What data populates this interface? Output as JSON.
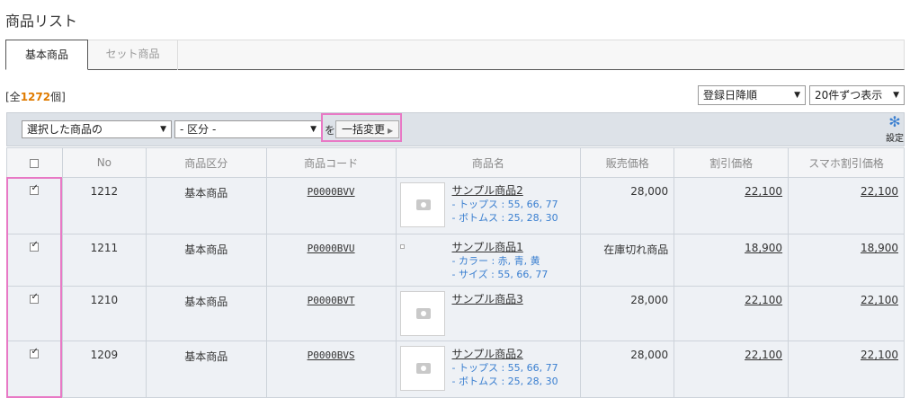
{
  "page_title": "商品リスト",
  "tabs": [
    {
      "label": "基本商品",
      "active": true
    },
    {
      "label": "セット商品",
      "active": false
    }
  ],
  "count": {
    "prefix": "[全",
    "number": "1272",
    "suffix": "個]"
  },
  "sort_select": {
    "value": "登録日降順"
  },
  "per_page_select": {
    "value": "20件ずつ表示"
  },
  "bulk": {
    "target_select": "選択した商品の",
    "category_select": "- 区分 -",
    "wo_label": "を",
    "button_label": "一括変更"
  },
  "settings_label": "設定",
  "columns": [
    "No",
    "商品区分",
    "商品コード",
    "商品名",
    "販売価格",
    "割引価格",
    "スマホ割引価格"
  ],
  "rows": [
    {
      "checked": true,
      "no": "1212",
      "type": "基本商品",
      "code": "P0000BVV",
      "has_thumb": true,
      "name": "サンプル商品2",
      "variants": [
        "- トップス : 55, 66, 77",
        "- ボトムス : 25, 28, 30"
      ],
      "price": "28,000",
      "discount": "22,100",
      "mobile_discount": "22,100"
    },
    {
      "checked": true,
      "no": "1211",
      "type": "基本商品",
      "code": "P0000BVU",
      "has_thumb": false,
      "name": "サンプル商品1",
      "variants": [
        "- カラー : 赤, 青, 黄",
        "- サイズ : 55, 66, 77"
      ],
      "price": "在庫切れ商品",
      "discount": "18,900",
      "mobile_discount": "18,900"
    },
    {
      "checked": true,
      "no": "1210",
      "type": "基本商品",
      "code": "P0000BVT",
      "has_thumb": true,
      "name": "サンプル商品3",
      "variants": [],
      "price": "28,000",
      "discount": "22,100",
      "mobile_discount": "22,100"
    },
    {
      "checked": true,
      "no": "1209",
      "type": "基本商品",
      "code": "P0000BVS",
      "has_thumb": true,
      "name": "サンプル商品2",
      "variants": [
        "- トップス : 55, 66, 77",
        "- ボトムス : 25, 28, 30"
      ],
      "price": "28,000",
      "discount": "22,100",
      "mobile_discount": "22,100"
    }
  ]
}
